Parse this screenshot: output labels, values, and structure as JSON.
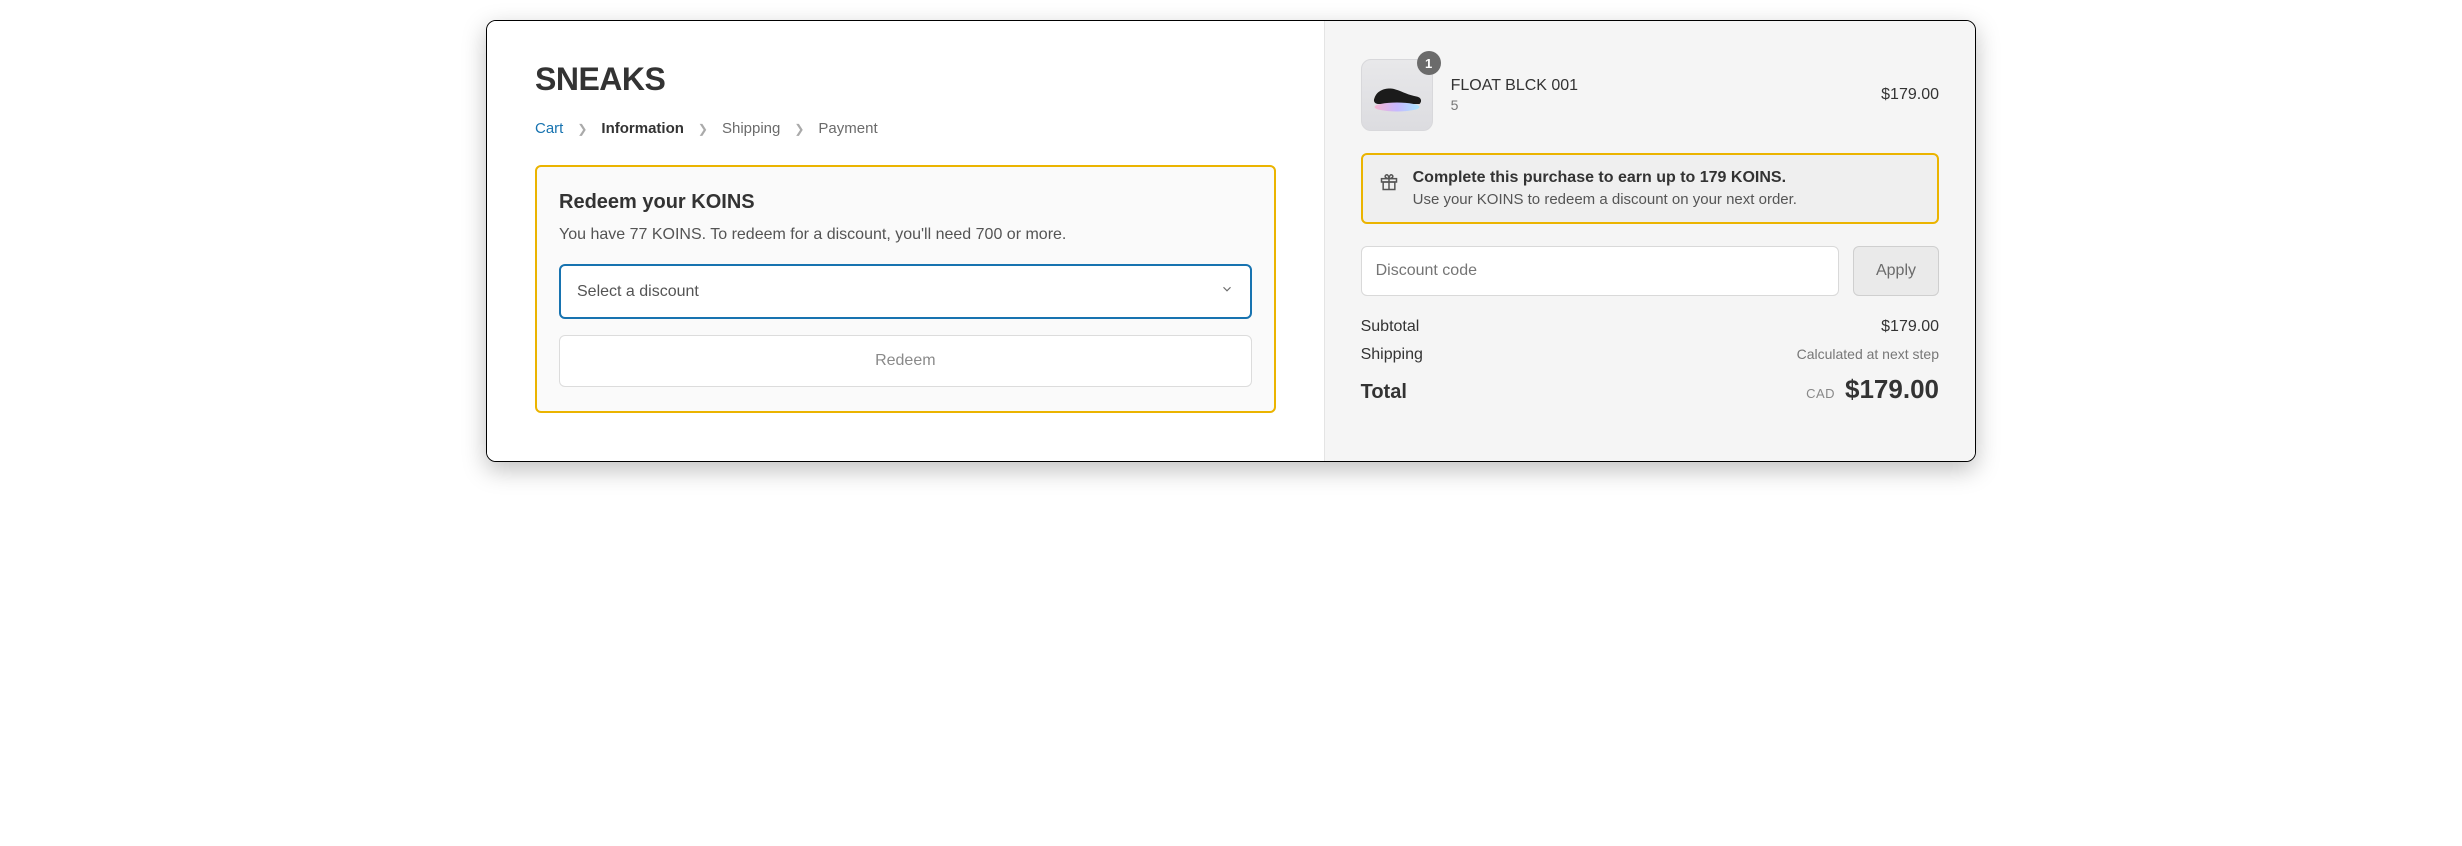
{
  "brand": "SNEAKS",
  "breadcrumbs": {
    "cart": "Cart",
    "information": "Information",
    "shipping": "Shipping",
    "payment": "Payment"
  },
  "redeem": {
    "title": "Redeem your KOINS",
    "subtitle": "You have 77 KOINS. To redeem for a discount, you'll need 700 or more.",
    "select_placeholder": "Select a discount",
    "button_label": "Redeem"
  },
  "cart": {
    "item": {
      "name": "FLOAT BLCK 001",
      "variant": "5",
      "price": "$179.00",
      "quantity": "1"
    }
  },
  "earn": {
    "title": "Complete this purchase to earn up to 179 KOINS.",
    "subtitle": "Use your KOINS to redeem a discount on your next order."
  },
  "discount": {
    "placeholder": "Discount code",
    "apply_label": "Apply"
  },
  "summary": {
    "subtotal_label": "Subtotal",
    "subtotal_value": "$179.00",
    "shipping_label": "Shipping",
    "shipping_note": "Calculated at next step",
    "total_label": "Total",
    "currency": "CAD",
    "total_value": "$179.00"
  }
}
